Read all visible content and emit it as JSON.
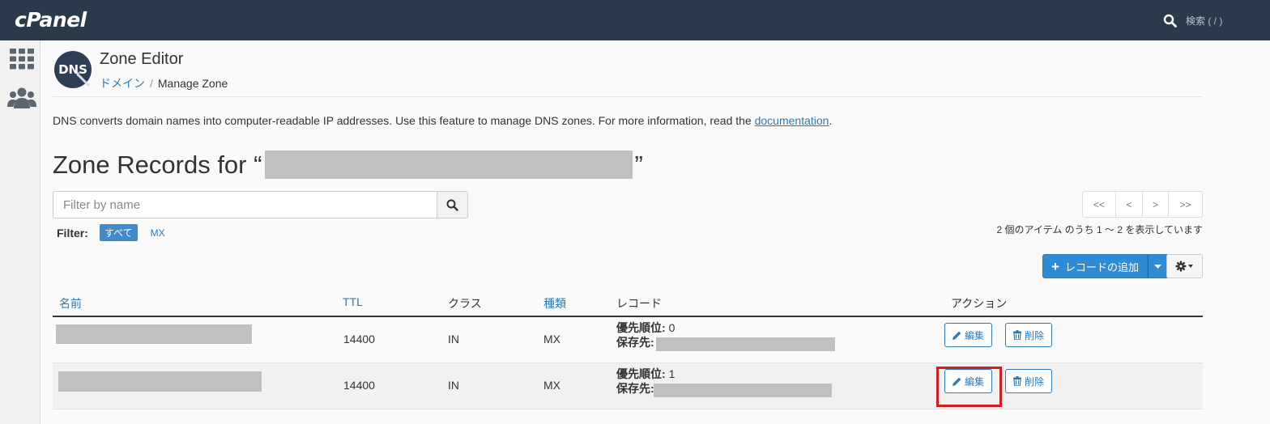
{
  "app": {
    "logo": "cPanel"
  },
  "topbar": {
    "search_label": "検索 ( / )"
  },
  "page": {
    "title": "Zone Editor",
    "breadcrumb": {
      "link": "ドメイン",
      "separator": "/",
      "current": "Manage Zone"
    },
    "description": {
      "text": "DNS converts domain names into computer-readable IP addresses. Use this feature to manage DNS zones. For more information, read the ",
      "link": "documentation",
      "suffix": "."
    },
    "heading_prefix": "Zone Records for “",
    "heading_suffix": "”"
  },
  "filter": {
    "placeholder": "Filter by name",
    "label": "Filter:",
    "options": [
      "すべて",
      "MX"
    ],
    "active": "すべて"
  },
  "pager": {
    "buttons": [
      "<<",
      "<",
      ">",
      ">>"
    ],
    "info": "2 個のアイテム のうち 1 ～ 2 を表示しています"
  },
  "toolbar": {
    "add_record_label": "レコードの追加"
  },
  "table": {
    "headers": {
      "name": "名前",
      "ttl": "TTL",
      "class": "クラス",
      "type": "種類",
      "record": "レコード",
      "actions": "アクション"
    },
    "rows": [
      {
        "ttl": "14400",
        "class": "IN",
        "type": "MX",
        "priority_label": "優先順位:",
        "priority": "0",
        "dest_label": "保存先:",
        "edit": "編集",
        "delete": "削除"
      },
      {
        "ttl": "14400",
        "class": "IN",
        "type": "MX",
        "priority_label": "優先順位:",
        "priority": "1",
        "dest_label": "保存先:",
        "edit": "編集",
        "delete": "削除"
      }
    ]
  },
  "colors": {
    "topbar": "#293a4a",
    "accent": "#2e7ab5",
    "primary_button": "#2f8bd4",
    "highlight": "#d21f26",
    "redaction": "#c0c0c0"
  }
}
